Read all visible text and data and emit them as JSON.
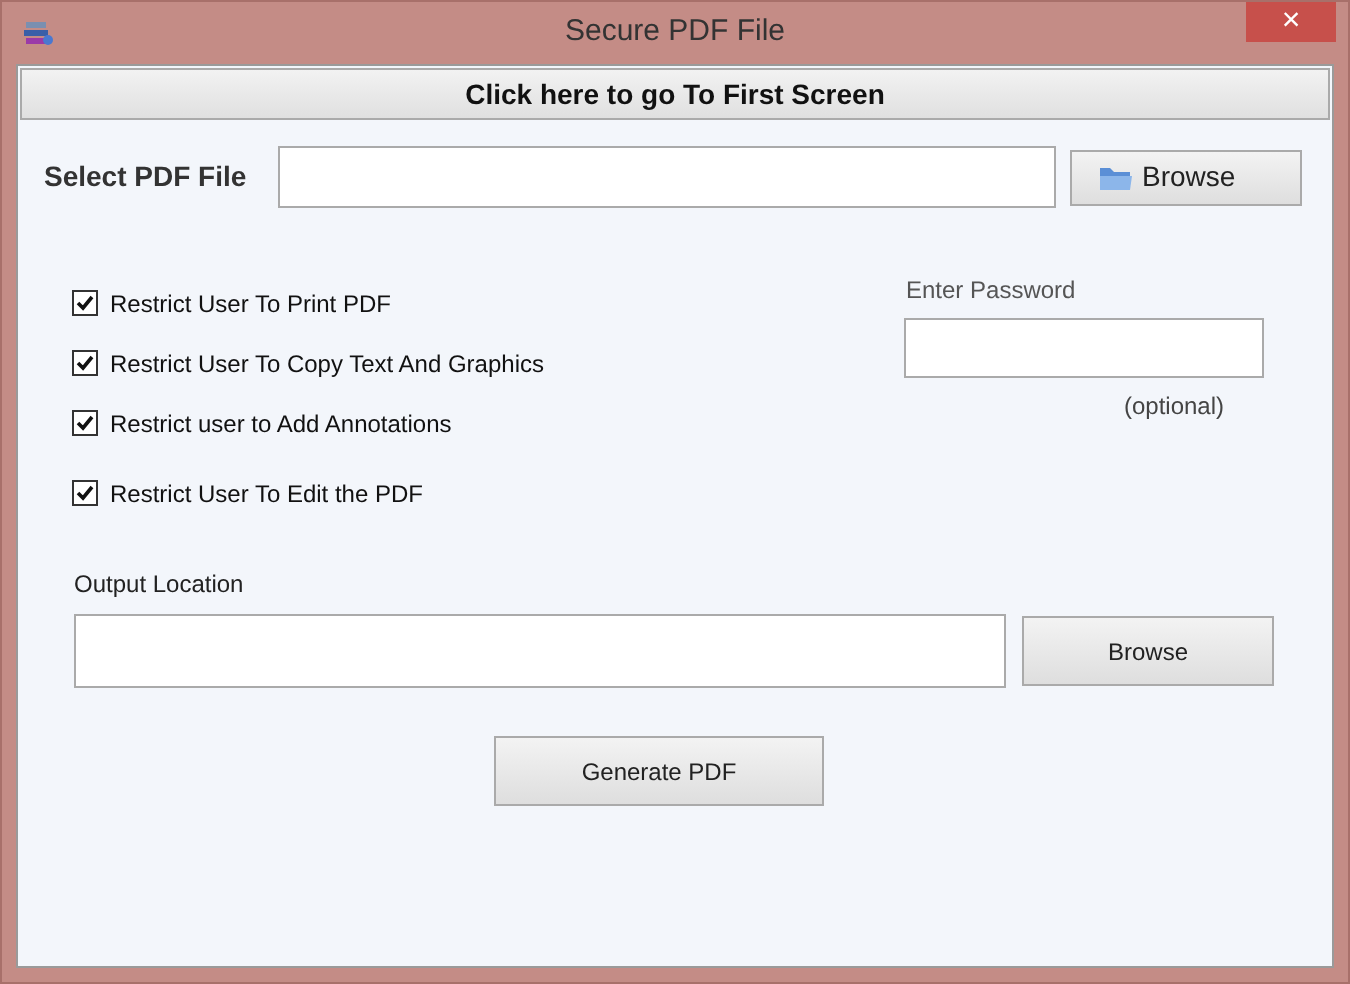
{
  "window": {
    "title": "Secure PDF File",
    "close": "×"
  },
  "first_screen_button": "Click here to go To First Screen",
  "select_pdf": {
    "label": "Select PDF File",
    "browse": "Browse"
  },
  "options": [
    {
      "label": "Restrict User To Print PDF",
      "checked": true
    },
    {
      "label": "Restrict User To Copy Text And Graphics",
      "checked": true
    },
    {
      "label": "Restrict user to Add Annotations",
      "checked": true
    },
    {
      "label": "Restrict User To Edit the PDF",
      "checked": true
    }
  ],
  "password": {
    "label": "Enter Password",
    "note": "(optional)"
  },
  "output": {
    "label": "Output Location",
    "browse": "Browse"
  },
  "generate_button": "Generate PDF"
}
